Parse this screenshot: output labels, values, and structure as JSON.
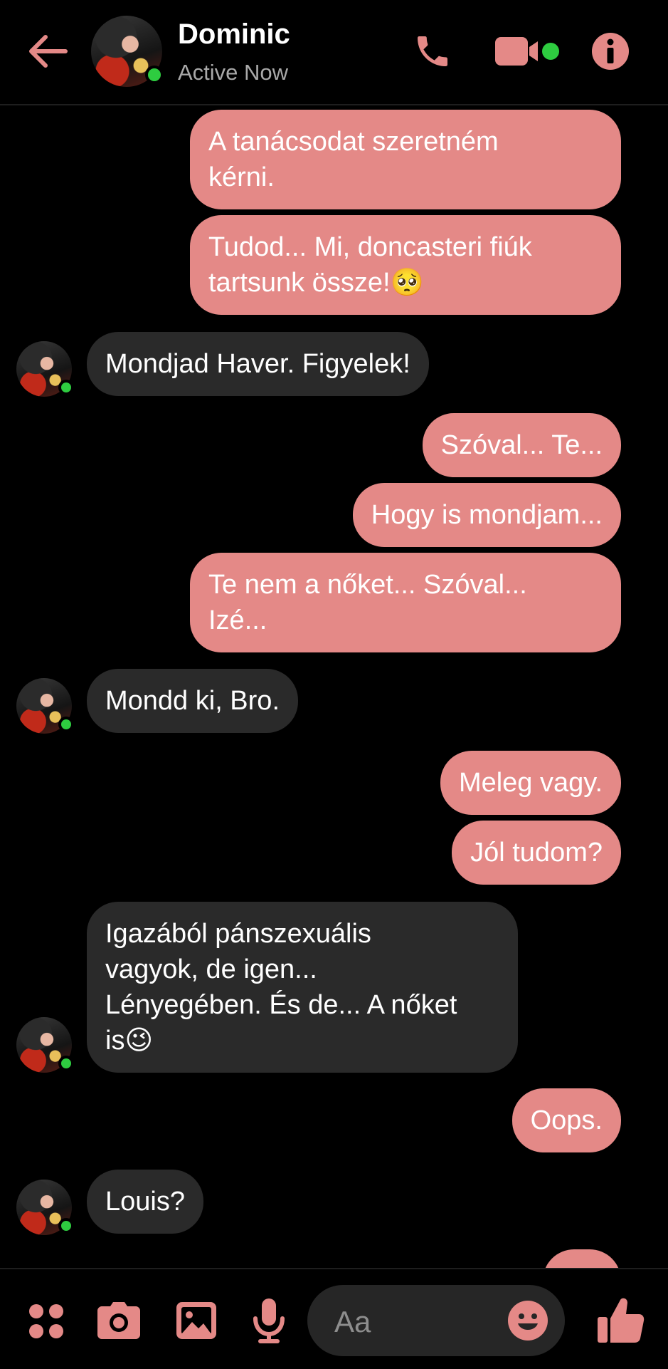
{
  "header": {
    "back_icon": "arrow-left-icon",
    "contact_name": "Dominic",
    "status": "Active Now",
    "call_icon": "phone-icon",
    "video_icon": "video-camera-icon",
    "info_icon": "info-icon",
    "accent_color": "#e48987",
    "online_color": "#2ecc40"
  },
  "messages": [
    {
      "side": "out",
      "lines": [
        "A tanácsodat szeretném",
        "kérni."
      ]
    },
    {
      "side": "out",
      "lines": [
        "Tudod... Mi, doncasteri fiúk",
        "tartsunk össze!🥺"
      ]
    },
    {
      "side": "in",
      "lines": [
        "Mondjad Haver. Figyelek!"
      ]
    },
    {
      "side": "out",
      "lines": [
        "Szóval... Te..."
      ]
    },
    {
      "side": "out",
      "lines": [
        "Hogy is mondjam..."
      ]
    },
    {
      "side": "out",
      "lines": [
        "Te nem a nőket... Szóval...",
        "Izé..."
      ]
    },
    {
      "side": "in",
      "lines": [
        "Mondd ki, Bro."
      ]
    },
    {
      "side": "out",
      "lines": [
        "Meleg vagy."
      ]
    },
    {
      "side": "out",
      "lines": [
        "Jól tudom?"
      ]
    },
    {
      "side": "in",
      "lines": [
        "Igazából pánszexuális",
        "vagyok, de igen...",
        "Lényegében. És de... A nőket",
        "is😉"
      ]
    },
    {
      "side": "out",
      "lines": [
        "Oops."
      ]
    },
    {
      "side": "in",
      "lines": [
        "Louis?"
      ]
    }
  ],
  "composer": {
    "apps_icon": "four-dots-menu-icon",
    "camera_icon": "camera-icon",
    "gallery_icon": "image-icon",
    "mic_icon": "microphone-icon",
    "placeholder": "Aa",
    "emoji_icon": "smiley-icon",
    "like_icon": "thumbs-up-icon"
  },
  "colors": {
    "background": "#000000",
    "outgoing_bubble": "#e48987",
    "incoming_bubble": "#2a2a2a",
    "secondary_text": "#a9a9a9"
  }
}
